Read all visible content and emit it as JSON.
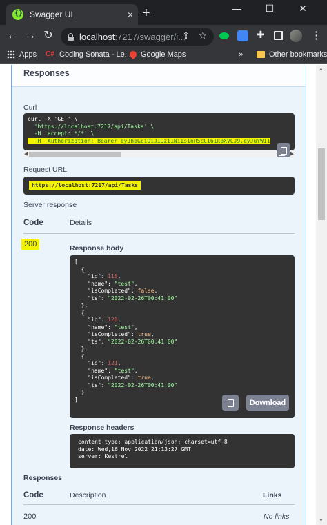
{
  "browser": {
    "tab_title": "Swagger UI",
    "tab_close": "×",
    "new_tab": "+",
    "window_controls": {
      "minimize": "—",
      "maximize": "☐",
      "close": "✕"
    },
    "url_host": "localhost",
    "url_path": ":7217/swagger/i...",
    "bookmarks": [
      "Apps",
      "Coding Sonata - Le...",
      "Google Maps"
    ],
    "bookmarks_more": "»",
    "other_bookmarks": "Other bookmarks"
  },
  "swagger": {
    "section_title": "Responses",
    "curl_label": "Curl",
    "curl_lines": [
      "curl -X 'GET' \\",
      "  'https://localhost:7217/api/Tasks' \\",
      "  -H 'accept: */*' \\",
      "  -H 'Authorization: Bearer eyJhbGciOiJIUzI1NiIsInR5cCI6IkpXVCJ9.eyJuYW11"
    ],
    "request_url_label": "Request URL",
    "request_url": "https://localhost:7217/api/Tasks",
    "server_response_label": "Server response",
    "code_header": "Code",
    "details_header": "Details",
    "status_code": "200",
    "response_body_label": "Response body",
    "response_body": [
      {
        "id": 118,
        "name": "test",
        "isCompleted": false,
        "ts": "2022-02-26T00:41:00"
      },
      {
        "id": 120,
        "name": "test",
        "isCompleted": true,
        "ts": "2022-02-26T00:41:00"
      },
      {
        "id": 121,
        "name": "test",
        "isCompleted": true,
        "ts": "2022-02-26T00:41:00"
      }
    ],
    "download_label": "Download",
    "response_headers_label": "Response headers",
    "response_headers": [
      "content-type: application/json; charset=utf-8",
      "date: Wed,16 Nov 2022 21:13:27 GMT",
      "server: Kestrel"
    ],
    "responses_label": "Responses",
    "description_header": "Description",
    "links_header": "Links",
    "resp_code": "200",
    "no_links": "No links"
  },
  "colors": {
    "panel_border": "#61affe",
    "panel_bg": "#ebf3fb",
    "code_bg": "#333333",
    "highlight": "#f3f300",
    "string": "#a2fca2",
    "number": "#d36363"
  }
}
